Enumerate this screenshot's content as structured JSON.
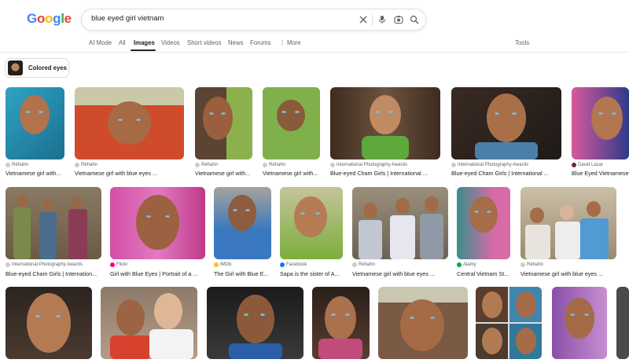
{
  "logo": {
    "letters": [
      "G",
      "o",
      "o",
      "g",
      "l",
      "e"
    ],
    "colors": [
      "#4285F4",
      "#EA4335",
      "#FBBC05",
      "#4285F4",
      "#34A853",
      "#EA4335"
    ]
  },
  "search": {
    "query": "blue eyed girl vietnam"
  },
  "icons": {
    "clear": "close-icon",
    "voice": "microphone-icon",
    "lens": "camera-lens-icon",
    "search": "search-icon"
  },
  "tabs": [
    "AI Mode",
    "All",
    "Images",
    "Videos",
    "Short videos",
    "News",
    "Forums",
    "More"
  ],
  "active_tab": "Images",
  "tools_label": "Tools",
  "chip": {
    "label": "Colored eyes"
  },
  "results": [
    {
      "source": "Réhahn",
      "title": "Vietnamese girl with..."
    },
    {
      "source": "Réhahn",
      "title": "Vietnamese girl with blue eyes ..."
    },
    {
      "source": "Réhahn",
      "title": "Vietnamese girl with..."
    },
    {
      "source": "Réhahn",
      "title": "Vietnamese girl with..."
    },
    {
      "source": "International Photography Awards",
      "title": "Blue-eyed Cham Girls | International ..."
    },
    {
      "source": "International Photography Awards",
      "title": "Blue-eyed Cham Girls | International ..."
    },
    {
      "source": "David Lazar",
      "title": "Blue Eyed Vietnamese"
    },
    {
      "source": "International Photography Awards",
      "title": "Blue-eyed Cham Girls | Internation..."
    },
    {
      "source": "Flickr",
      "title": "Girl with Blue Eyes | Portrait of a ..."
    },
    {
      "source": "IMDb",
      "title": "The Girl with Blue E..."
    },
    {
      "source": "Facebook",
      "title": "Sapa is the sister of A..."
    },
    {
      "source": "Réhahn",
      "title": "Vietnamese girl with blue eyes ..."
    },
    {
      "source": "Alamy",
      "title": "Central Vietnam St..."
    },
    {
      "source": "Réhahn",
      "title": "Vietnamese girl with blue eyes ..."
    }
  ]
}
